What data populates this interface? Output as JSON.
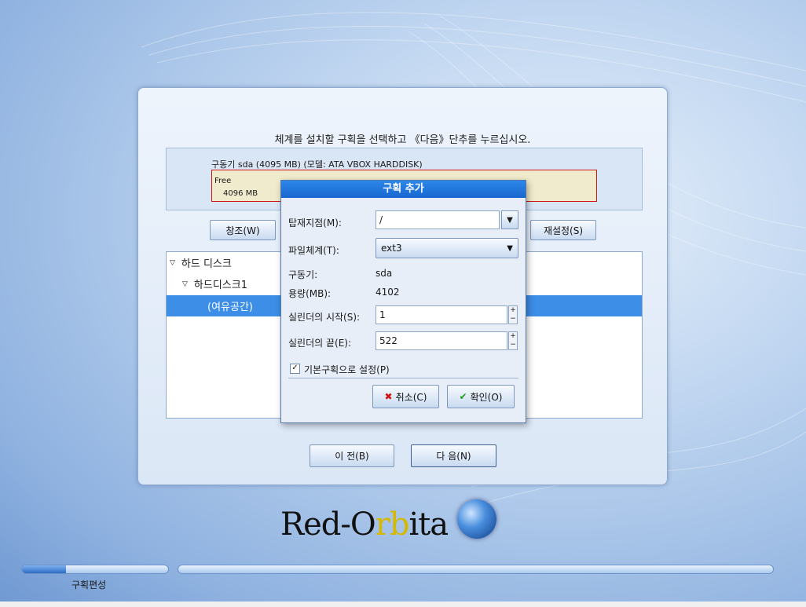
{
  "instruction": "체계를 설치할 구획을 선택하고 《다음》단추를 누르십시오.",
  "disk": {
    "label": "구동기 sda (4095 MB) (모델: ATA VBOX HARDDISK)",
    "free_label": "Free",
    "free_size": "4096 MB"
  },
  "buttons": {
    "create": "창조(W)",
    "reset": "재설정(S)",
    "back": "이 전(B)",
    "next": "다 음(N)"
  },
  "tree": {
    "root": "하드 디스크",
    "disk": "하드디스크1",
    "free": "(여유공간)"
  },
  "dialog": {
    "title": "구획 추가",
    "mount_label": "탑재지점(M):",
    "mount_value": "/",
    "fs_label": "파일체계(T):",
    "fs_value": "ext3",
    "drive_label": "구동기:",
    "drive_value": "sda",
    "size_label": "용량(MB):",
    "size_value": "4102",
    "start_label": "실린더의 시작(S):",
    "start_value": "1",
    "end_label": "실린더의 끝(E):",
    "end_value": "522",
    "primary_label": "기본구획으로 설정(P)",
    "primary_checked": true,
    "cancel": "취소(C)",
    "ok": "확인(O)"
  },
  "logo": {
    "part1": "Red-O",
    "part2": "r",
    "part3": "b",
    "part4": "ita"
  },
  "progress": {
    "step_label": "구획편성",
    "step_fraction": 0.3
  },
  "colors": {
    "selection": "#3d8ee6",
    "title_bar": "#1767cf",
    "free_border": "#d01515"
  }
}
